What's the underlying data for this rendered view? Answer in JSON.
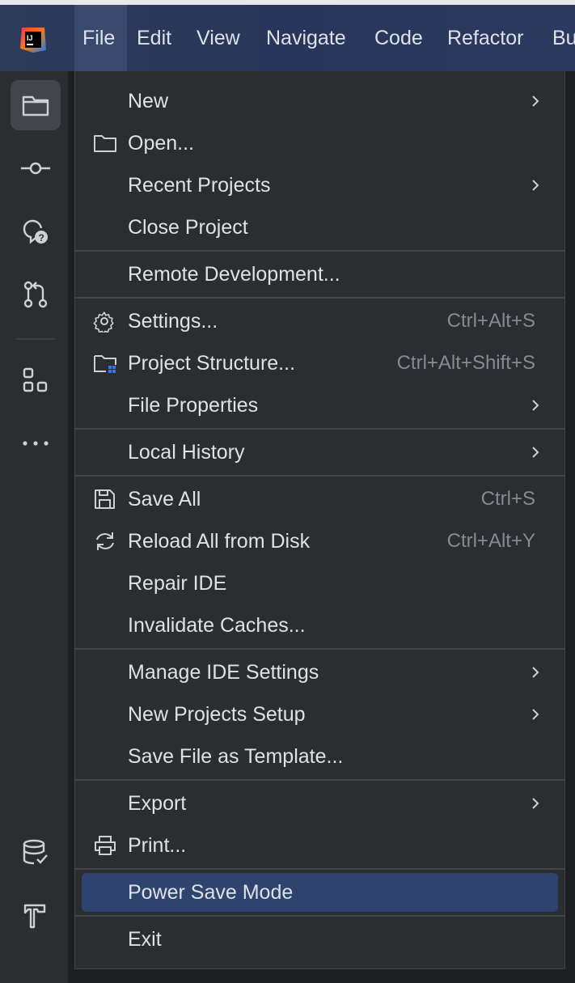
{
  "window": {
    "menubar": {
      "items": [
        "File",
        "Edit",
        "View",
        "Navigate",
        "Code",
        "Refactor",
        "Bu"
      ],
      "active": "File"
    }
  },
  "toolwindows": [
    {
      "name": "project-folder-icon",
      "selected": true
    },
    {
      "name": "commit-icon"
    },
    {
      "name": "ai-assistant-icon"
    },
    {
      "name": "pull-requests-icon"
    },
    {
      "name": "structure-icon"
    },
    {
      "name": "more-icon"
    },
    {
      "name": "database-icon"
    },
    {
      "name": "build-hammer-icon"
    }
  ],
  "file_menu": {
    "groups": [
      [
        {
          "label": "New",
          "submenu": true
        },
        {
          "label": "Open...",
          "icon": "folder-icon"
        },
        {
          "label": "Recent Projects",
          "submenu": true
        },
        {
          "label": "Close Project"
        }
      ],
      [
        {
          "label": "Remote Development..."
        }
      ],
      [
        {
          "label": "Settings...",
          "icon": "gear-icon",
          "shortcut": "Ctrl+Alt+S"
        },
        {
          "label": "Project Structure...",
          "icon": "project-structure-icon",
          "shortcut": "Ctrl+Alt+Shift+S"
        },
        {
          "label": "File Properties",
          "submenu": true
        }
      ],
      [
        {
          "label": "Local History",
          "submenu": true
        }
      ],
      [
        {
          "label": "Save All",
          "icon": "save-icon",
          "shortcut": "Ctrl+S"
        },
        {
          "label": "Reload All from Disk",
          "icon": "reload-icon",
          "shortcut": "Ctrl+Alt+Y"
        },
        {
          "label": "Repair IDE"
        },
        {
          "label": "Invalidate Caches..."
        }
      ],
      [
        {
          "label": "Manage IDE Settings",
          "submenu": true
        },
        {
          "label": "New Projects Setup",
          "submenu": true
        },
        {
          "label": "Save File as Template..."
        }
      ],
      [
        {
          "label": "Export",
          "submenu": true
        },
        {
          "label": "Print...",
          "icon": "printer-icon"
        }
      ],
      [
        {
          "label": "Power Save Mode",
          "highlighted": true
        }
      ],
      [
        {
          "label": "Exit"
        }
      ]
    ]
  },
  "colors": {
    "menubar_bg": "#2a3a5e",
    "menu_bg": "#2b2d30",
    "highlight": "#2e436e",
    "text": "#dfe1e5",
    "shortcut_text": "#868a91"
  }
}
